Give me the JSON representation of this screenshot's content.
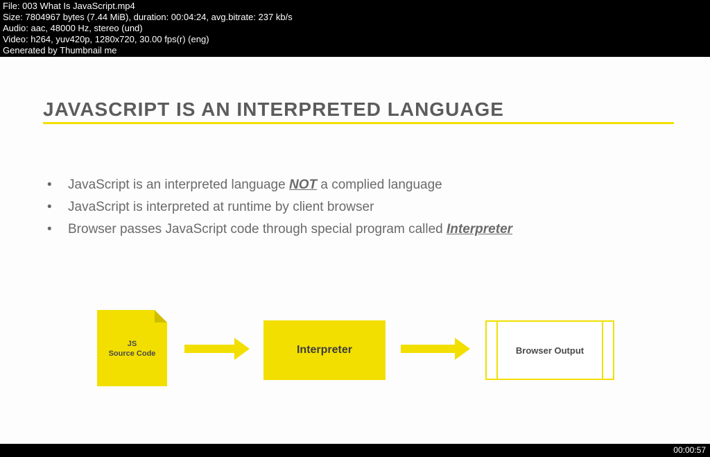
{
  "header": {
    "file": "File: 003 What Is JavaScript.mp4",
    "size": "Size: 7804967 bytes (7.44 MiB), duration: 00:04:24, avg.bitrate: 237 kb/s",
    "audio": "Audio: aac, 48000 Hz, stereo (und)",
    "video": "Video: h264, yuv420p, 1280x720, 30.00 fps(r) (eng)",
    "generated": "Generated by Thumbnail me"
  },
  "slide": {
    "title": "JAVASCRIPT IS AN INTERPRETED LANGUAGE",
    "bullets": [
      {
        "pre": "JavaScript is an interpreted language ",
        "em": "NOT",
        "post": " a complied language"
      },
      {
        "pre": "JavaScript is interpreted at runtime by client browser",
        "em": "",
        "post": ""
      },
      {
        "pre": "Browser passes JavaScript code through special program called ",
        "em": "Interpreter",
        "post": ""
      }
    ],
    "diagram": {
      "src_line1": "JS",
      "src_line2": "Source Code",
      "interpreter": "Interpreter",
      "browser": "Browser Output"
    }
  },
  "timestamp": "00:00:57"
}
